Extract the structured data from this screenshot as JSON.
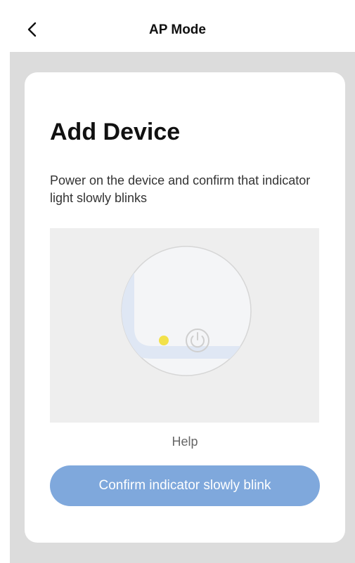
{
  "header": {
    "back_icon": "chevron-left-icon",
    "title": "AP Mode"
  },
  "card": {
    "title": "Add Device",
    "description": "Power on the device and confirm that indicator light slowly blinks",
    "illustration": {
      "indicator_color": "#f2e14a",
      "power_icon": "power-icon"
    },
    "help_label": "Help",
    "confirm_label": "Confirm indicator slowly blink"
  },
  "colors": {
    "background": "#dcdcdc",
    "card": "#ffffff",
    "button": "#7fa8dc",
    "illustration_bg": "#eeeeee"
  }
}
